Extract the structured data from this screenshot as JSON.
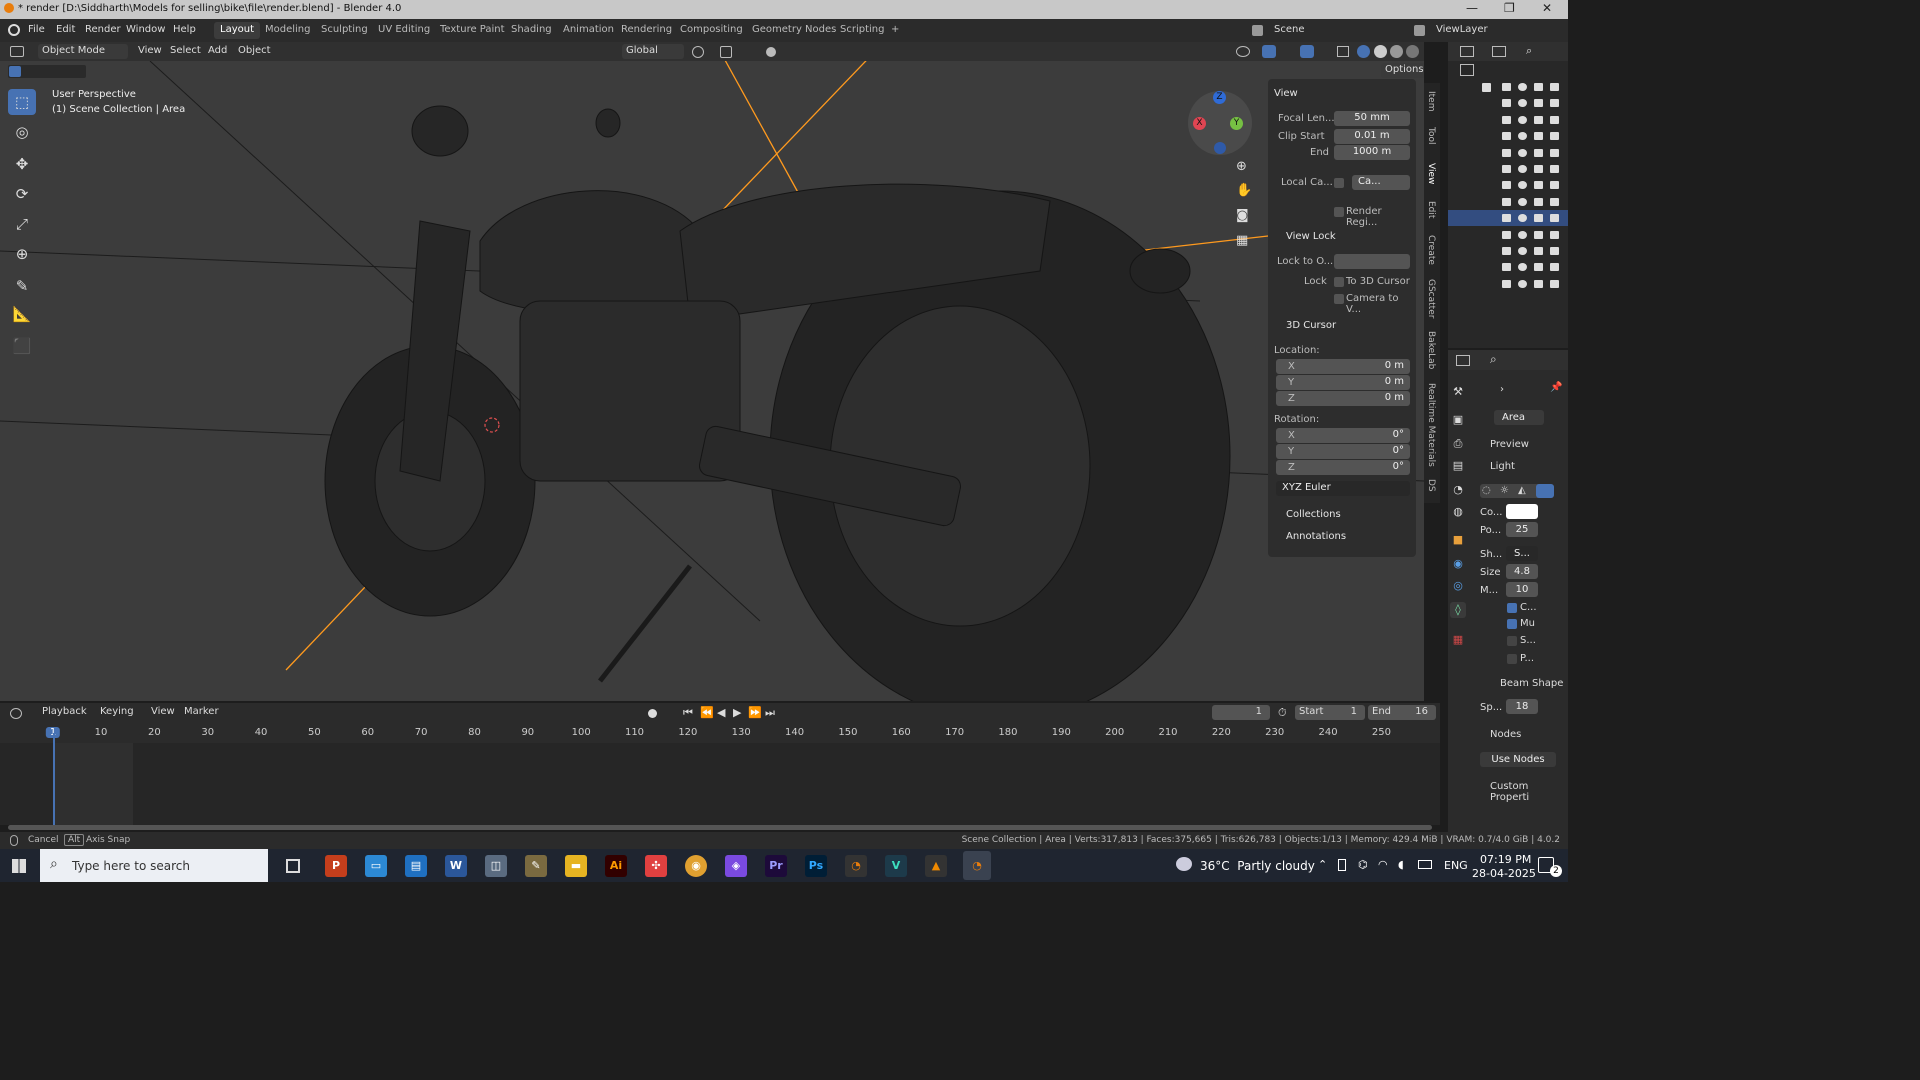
{
  "window": {
    "title": "* render [D:\\Siddharth\\Models for selling\\bike\\file\\render.blend] - Blender 4.0",
    "controls": [
      "—",
      "❐",
      "✕"
    ]
  },
  "menu": {
    "items": [
      "File",
      "Edit",
      "Render",
      "Window",
      "Help"
    ]
  },
  "workspaces": [
    "Layout",
    "Modeling",
    "Sculpting",
    "UV Editing",
    "Texture Paint",
    "Shading",
    "Animation",
    "Rendering",
    "Compositing",
    "Geometry Nodes",
    "Scripting",
    "+"
  ],
  "scene": {
    "label": "Scene",
    "viewlayer": "ViewLayer"
  },
  "viewport_header": {
    "mode": "Object Mode",
    "menus": [
      "View",
      "Select",
      "Add",
      "Object"
    ],
    "orientation": "Global",
    "options": "Options"
  },
  "overlay": {
    "perspective": "User Perspective",
    "collection": "(1) Scene Collection | Area"
  },
  "gizmo": {
    "x": "X",
    "y": "Y",
    "z": "Z"
  },
  "npanel": {
    "view_header": "View",
    "focal_label": "Focal Len...",
    "focal_value": "50 mm",
    "clip_start_label": "Clip Start",
    "clip_start_value": "0.01 m",
    "clip_end_label": "End",
    "clip_end_value": "1000 m",
    "local_camera_label": "Local Ca...",
    "local_camera_value": "Ca...",
    "render_region": "Render Regi...",
    "view_lock_header": "View Lock",
    "lock_to_label": "Lock to O...",
    "lock_label": "Lock",
    "to_cursor": "To 3D Cursor",
    "camera_to_view": "Camera to V...",
    "cursor_header": "3D Cursor",
    "location_label": "Location:",
    "loc_x_label": "X",
    "loc_x": "0 m",
    "loc_y_label": "Y",
    "loc_y": "0 m",
    "loc_z_label": "Z",
    "loc_z": "0 m",
    "rotation_label": "Rotation:",
    "rot_x_label": "X",
    "rot_x": "0°",
    "rot_y_label": "Y",
    "rot_y": "0°",
    "rot_z_label": "Z",
    "rot_z": "0°",
    "rotation_mode": "XYZ Euler",
    "collections": "Collections",
    "annotations": "Annotations"
  },
  "sidebar_tabs": [
    "Item",
    "Tool",
    "View",
    "Edit",
    "Create",
    "GScatter",
    "BakeLab",
    "Realtime Materials",
    "DS"
  ],
  "properties": {
    "object_name": "Area",
    "preview": "Preview",
    "light": "Light",
    "color_label": "Co...",
    "power_label": "Po...",
    "power_value": "25",
    "shape_label": "Sh...",
    "shape_value": "S...",
    "size_label": "Size",
    "size_value": "4.8",
    "m_label": "M...",
    "m_value": "10",
    "c_label": "C...",
    "mu_label": "Mu",
    "s_label": "S...",
    "p_label": "P...",
    "beam_shape": "Beam Shape",
    "spread_label": "Sp...",
    "spread_value": "18",
    "nodes": "Nodes",
    "use_nodes": "Use Nodes",
    "custom_props": "Custom Properti"
  },
  "timeline": {
    "menus": [
      "Playback",
      "Keying",
      "View",
      "Marker"
    ],
    "current_frame": "1",
    "start_label": "Start",
    "start_value": "1",
    "end_label": "End",
    "end_value": "16",
    "ticks": [
      "1",
      "10",
      "20",
      "30",
      "40",
      "50",
      "60",
      "70",
      "80",
      "90",
      "100",
      "110",
      "120",
      "130",
      "140",
      "150",
      "160",
      "170",
      "180",
      "190",
      "200",
      "210",
      "220",
      "230",
      "240",
      "250"
    ]
  },
  "status": {
    "cancel": "Cancel",
    "alt": "Alt",
    "axis_snap": "Axis Snap",
    "stats": "Scene Collection | Area | Verts:317,813 | Faces:375,665 | Tris:626,783 | Objects:1/13 | Memory: 429.4 MiB | VRAM: 0.7/4.0 GiB | 4.0.2"
  },
  "taskbar": {
    "search_placeholder": "Type here to search",
    "weather": "36°C  Partly cloudy",
    "lang": "ENG",
    "time": "07:19 PM",
    "date": "28-04-2025",
    "notif": "2",
    "apps": [
      "Ps",
      "Ai",
      "W",
      "Pr"
    ]
  }
}
